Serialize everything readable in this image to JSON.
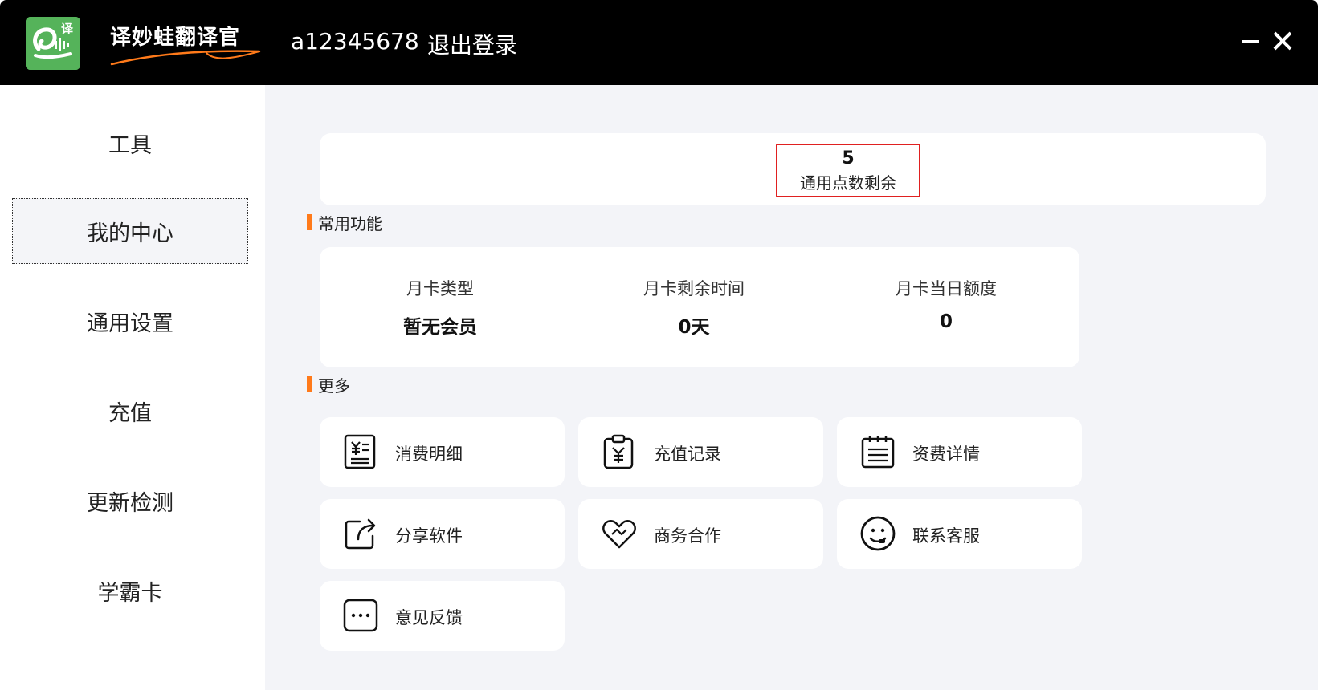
{
  "header": {
    "app_name": "译妙蛙翻译官",
    "logo_char": "译",
    "username": "a12345678",
    "logout_label": "退出登录"
  },
  "sidebar": {
    "items": [
      {
        "label": "工具"
      },
      {
        "label": "我的中心"
      },
      {
        "label": "通用设置"
      },
      {
        "label": "充值"
      },
      {
        "label": "更新检测"
      },
      {
        "label": "学霸卡"
      }
    ],
    "active_index": 1
  },
  "points": {
    "value": "5",
    "label": "通用点数剩余"
  },
  "common": {
    "title": "常用功能",
    "columns": [
      {
        "label": "月卡类型",
        "value": "暂无会员"
      },
      {
        "label": "月卡剩余时间",
        "value": "0天"
      },
      {
        "label": "月卡当日额度",
        "value": "0"
      }
    ]
  },
  "more": {
    "title": "更多",
    "tiles": [
      {
        "label": "消费明细",
        "icon": "receipt-icon"
      },
      {
        "label": "充值记录",
        "icon": "clipboard-yen-icon"
      },
      {
        "label": "资费详情",
        "icon": "calendar-list-icon"
      },
      {
        "label": "分享软件",
        "icon": "share-icon"
      },
      {
        "label": "商务合作",
        "icon": "heart-handshake-icon"
      },
      {
        "label": "联系客服",
        "icon": "customer-service-icon"
      },
      {
        "label": "意见反馈",
        "icon": "chat-dots-icon"
      }
    ]
  },
  "colors": {
    "titlebar": "#000000",
    "accent_orange": "#ff7a1a",
    "highlight_red": "#e02020",
    "logo_green": "#55b35a",
    "main_bg": "#f3f4f8"
  }
}
